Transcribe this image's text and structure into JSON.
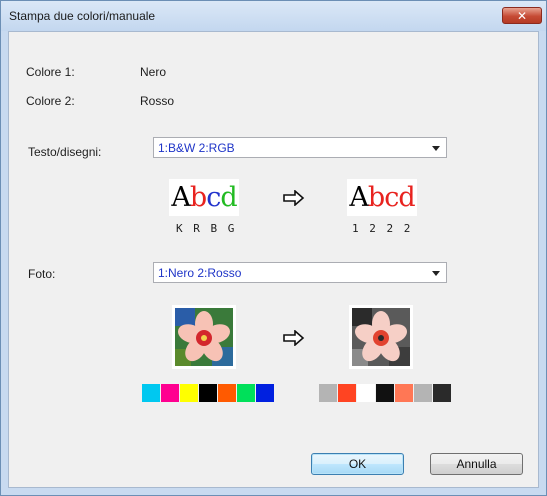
{
  "window": {
    "title": "Stampa due colori/manuale",
    "close_glyph": "✕"
  },
  "colors": {
    "color1_label": "Colore 1:",
    "color1_value": "Nero",
    "color2_label": "Colore 2:",
    "color2_value": "Rosso"
  },
  "text_section": {
    "label": "Testo/disegni:",
    "selected": "1:B&W 2:RGB",
    "before_sample": {
      "letters": [
        "A",
        "b",
        "c",
        "d"
      ],
      "colors": [
        "#000000",
        "#e8231f",
        "#2233cc",
        "#22bb22"
      ],
      "codes": "K R B G"
    },
    "after_sample": {
      "letters": [
        "A",
        "b",
        "c",
        "d"
      ],
      "colors": [
        "#000000",
        "#e8231f",
        "#e8231f",
        "#e8231f"
      ],
      "codes": "1 2 2 2"
    }
  },
  "photo_section": {
    "label": "Foto:",
    "selected": "1:Nero 2:Rosso",
    "before_swatches": [
      "#00c8f0",
      "#ff0090",
      "#ffff00",
      "#000000",
      "#ff5a00",
      "#00e05a",
      "#0020e0"
    ],
    "after_swatches": [
      "#b4b4b4",
      "#ff4422",
      "#ffffff",
      "#111111",
      "#ff7755",
      "#b4b4b4",
      "#2a2a2a"
    ]
  },
  "buttons": {
    "ok": "OK",
    "cancel": "Annulla"
  },
  "icons": {
    "arrow": "right-arrow-icon",
    "close": "close-icon"
  }
}
